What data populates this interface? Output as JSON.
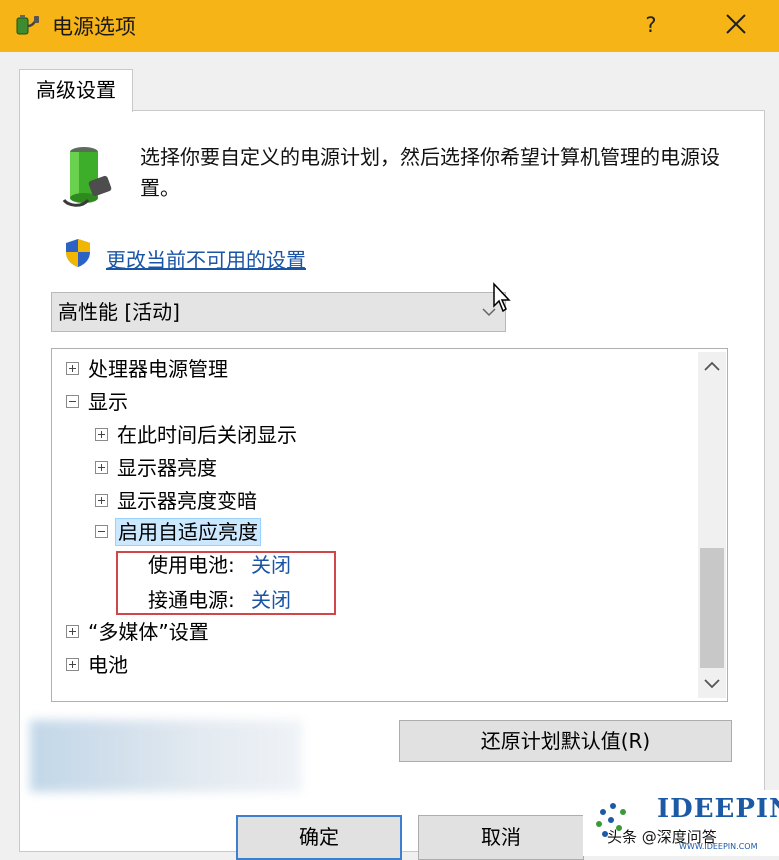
{
  "window": {
    "title": "电源选项",
    "help_label": "?",
    "accent_color": "#f7b417"
  },
  "tab": {
    "label": "高级设置"
  },
  "description": "选择你要自定义的电源计划，然后选择你希望计算机管理的电源设置。",
  "change_settings_link": "更改当前不可用的设置",
  "plan_select": {
    "value": "高性能 [活动]"
  },
  "tree": {
    "items": [
      {
        "label": "处理器电源管理",
        "state": "collapsed"
      },
      {
        "label": "显示",
        "state": "expanded"
      },
      {
        "label": "在此时间后关闭显示",
        "state": "collapsed"
      },
      {
        "label": "显示器亮度",
        "state": "collapsed"
      },
      {
        "label": "显示器亮度变暗",
        "state": "collapsed"
      },
      {
        "label": "启用自适应亮度",
        "state": "expanded",
        "selected": true
      },
      {
        "label": "使用电池:",
        "value": "关闭"
      },
      {
        "label": "接通电源:",
        "value": "关闭"
      },
      {
        "label": "“多媒体”设置",
        "state": "collapsed"
      },
      {
        "label": "电池",
        "state": "collapsed"
      }
    ]
  },
  "buttons": {
    "restore": "还原计划默认值(R)",
    "ok": "确定",
    "cancel": "取消"
  },
  "watermark": {
    "brand": "IDEEPIN",
    "credit": "头条 @深度问答",
    "url": "WWW.IDEEPIN.COM"
  },
  "icons": {
    "app": "power-options-icon",
    "battery": "battery-plug-icon",
    "shield": "uac-shield-icon",
    "close": "close-icon",
    "select": "chevron-down-icon"
  }
}
